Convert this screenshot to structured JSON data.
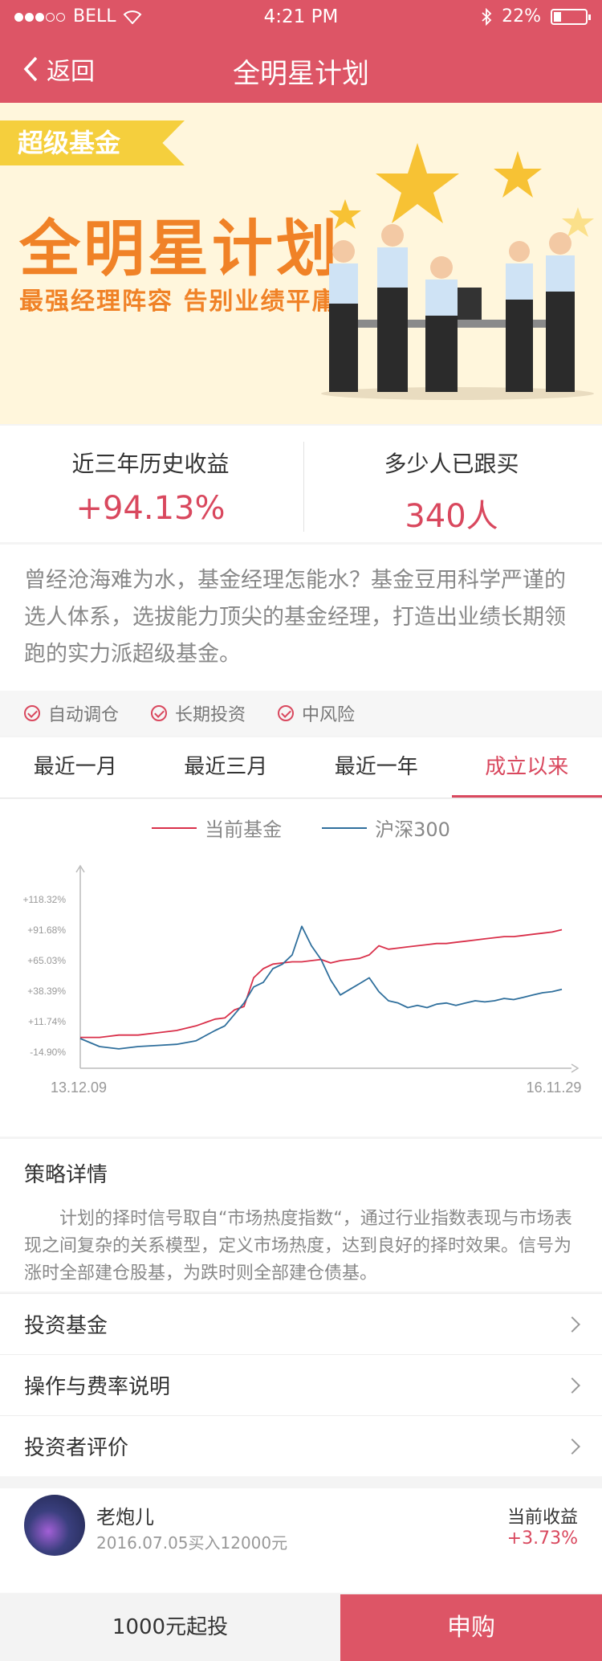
{
  "status": {
    "carrier": "BELL",
    "time": "4:21 PM",
    "battery": "22%"
  },
  "nav": {
    "back_label": "返回",
    "title": "全明星计划"
  },
  "banner": {
    "tag": "超级基金",
    "headline": "全明星计划",
    "subline": "最强经理阵容  告别业绩平庸"
  },
  "stats": {
    "return_label": "近三年历史收益",
    "return_value": "+94.13%",
    "followers_label": "多少人已跟买",
    "followers_value": "340人"
  },
  "description": "曾经沧海难为水，基金经理怎能水？基金豆用科学严谨的选人体系，选拔能力顶尖的基金经理，打造出业绩长期领跑的实力派超级基金。",
  "features": [
    "自动调仓",
    "长期投资",
    "中风险"
  ],
  "tabs": [
    {
      "label": "最近一月",
      "active": false
    },
    {
      "label": "最近三月",
      "active": false
    },
    {
      "label": "最近一年",
      "active": false
    },
    {
      "label": "成立以来",
      "active": true
    }
  ],
  "chart_data": {
    "type": "line",
    "legend": [
      "当前基金",
      "沪深300"
    ],
    "colors": {
      "fund": "#d9304a",
      "index": "#2f6f9c"
    },
    "yticks": [
      -14.9,
      11.74,
      38.39,
      65.03,
      91.68,
      118.32
    ],
    "ytick_labels": [
      "-14.90%",
      "+11.74%",
      "+38.39%",
      "+65.03%",
      "+91.68%",
      "+118.32%"
    ],
    "ylim": [
      -14.9,
      118.32
    ],
    "x_start_label": "13.12.09",
    "x_end_label": "16.11.29",
    "x": [
      0,
      0.04,
      0.08,
      0.12,
      0.16,
      0.2,
      0.24,
      0.28,
      0.3,
      0.32,
      0.34,
      0.36,
      0.38,
      0.4,
      0.42,
      0.44,
      0.46,
      0.48,
      0.5,
      0.52,
      0.54,
      0.56,
      0.58,
      0.6,
      0.62,
      0.64,
      0.66,
      0.68,
      0.7,
      0.72,
      0.74,
      0.76,
      0.78,
      0.8,
      0.82,
      0.84,
      0.86,
      0.88,
      0.9,
      0.92,
      0.94,
      0.96,
      0.98,
      1.0
    ],
    "series": [
      {
        "name": "当前基金",
        "values": [
          -2,
          -2,
          0,
          0,
          2,
          4,
          8,
          14,
          15,
          22,
          25,
          50,
          58,
          62,
          63,
          64,
          64,
          65,
          66,
          63,
          65,
          66,
          67,
          70,
          78,
          75,
          76,
          77,
          78,
          79,
          80,
          80,
          81,
          82,
          83,
          84,
          85,
          86,
          86,
          87,
          88,
          89,
          90,
          92
        ]
      },
      {
        "name": "沪深300",
        "values": [
          -3,
          -10,
          -12,
          -10,
          -9,
          -8,
          -5,
          4,
          8,
          18,
          28,
          42,
          46,
          58,
          62,
          70,
          95,
          78,
          66,
          48,
          35,
          40,
          45,
          50,
          38,
          30,
          28,
          24,
          26,
          24,
          27,
          28,
          26,
          28,
          30,
          29,
          30,
          32,
          31,
          33,
          35,
          37,
          38,
          40
        ]
      }
    ]
  },
  "strategy": {
    "title": "策略详情",
    "text": "计划的择时信号取自“市场热度指数“，通过行业指数表现与市场表现之间复杂的关系模型，定义市场热度，达到良好的择时效果。信号为涨时全部建仓股基，为跌时则全部建仓债基。"
  },
  "links": [
    "投资基金",
    "操作与费率说明",
    "投资者评价"
  ],
  "comment": {
    "name": "老炮儿",
    "meta": "2016.07.05买入12000元",
    "gain_label": "当前收益",
    "gain_value": "+3.73%"
  },
  "bottom": {
    "min_invest": "1000元起投",
    "buy_label": "申购"
  }
}
